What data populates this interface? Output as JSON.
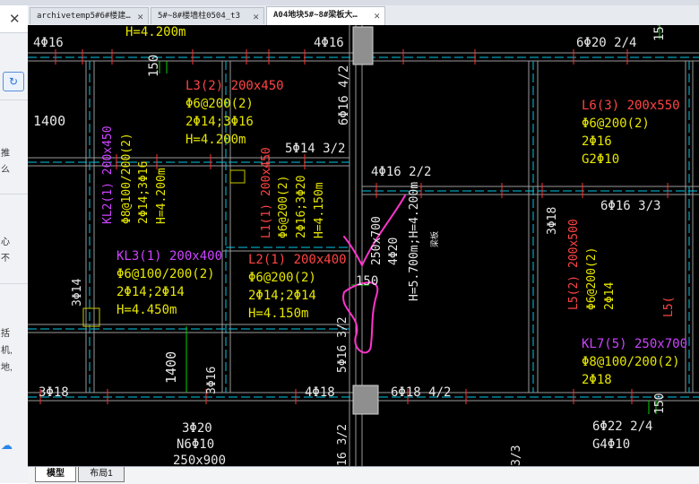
{
  "tabs": [
    {
      "label": "archivetemp5#6#楼建…",
      "active": false
    },
    {
      "label": "5#~8#楼墙柱0504_t3",
      "active": false
    },
    {
      "label": "A04地块5#~8#梁板大…",
      "active": true
    }
  ],
  "left_panel": {
    "close_label": "✕",
    "refresh_label": "↻",
    "snippets": [
      "推",
      "么",
      "心",
      "不",
      "括",
      "机,",
      "地,"
    ]
  },
  "layout_tabs": [
    "模型",
    "布局1"
  ],
  "cad_labels": {
    "t1": "4Φ16",
    "t2": "H=4.200m",
    "t3": "4Φ16",
    "t4": "6Φ20 2/4",
    "t5": "150",
    "t6": "150",
    "t7": "L3(2) 200x450",
    "t8": "Φ6@200(2)",
    "t9": "2Φ14;3Φ16",
    "t10": "H=4.200m",
    "t11": "1400",
    "t12": "6Φ16 4/2",
    "t13": "L6(3) 200x550",
    "t14": "Φ6@200(2)",
    "t15": "2Φ16",
    "t16": "G2Φ10",
    "t17": "5Φ14 3/2",
    "t18": "4Φ16 2/2",
    "t19": "KL2(1) 200x450",
    "t20": "Φ8@100/200(2)",
    "t21": "2Φ14;3Φ16",
    "t22": "H=4.200m",
    "t23": "L1(1) 200x450",
    "t24": "Φ6@200(2)",
    "t25": "2Φ16;3Φ20",
    "t26": "H=4.150m",
    "t27": "6Φ16 3/3",
    "t28": "250x700",
    "t29": "4Φ20",
    "t30": "H=5.700m;H=4.200m",
    "t31": "梁板",
    "t32": "3Φ18",
    "t33": "KL3(1) 200x400",
    "t34": "Φ6@100/200(2)",
    "t35": "2Φ14;2Φ14",
    "t36": "H=4.450m",
    "t37": "L2(1) 200x400",
    "t38": "Φ6@200(2)",
    "t39": "2Φ14;2Φ14",
    "t40": "H=4.150m",
    "t41": "150",
    "t42": "3Φ14",
    "t43": "L5(2) 200x500",
    "t44": "Φ6@200(2)",
    "t45": "2Φ14",
    "t46": "L5(",
    "t47": "5Φ16 3/2",
    "t48": "KL7(5) 250x700",
    "t49": "Φ8@100/200(2)",
    "t50": "2Φ18",
    "t51": "1400",
    "t52": "3Φ16",
    "t53": "3Φ18",
    "t54": "4Φ18",
    "t55": "6Φ18 4/2",
    "t56": "150",
    "t57": "3Φ20",
    "t58": "N6Φ10",
    "t59": "250x900",
    "t60": "6Φ22 2/4",
    "t61": "G4Φ10",
    "t62": "16 3/2",
    "t63": "3/3"
  }
}
